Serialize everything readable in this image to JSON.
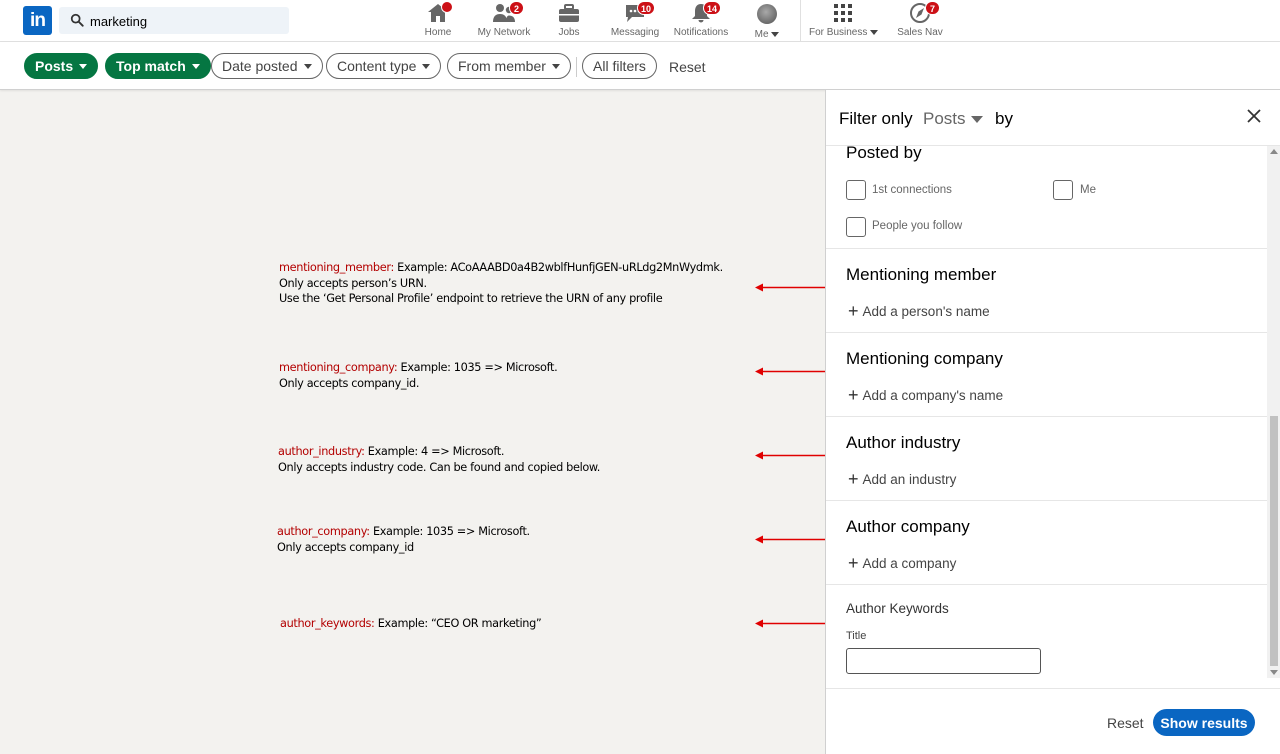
{
  "search": {
    "query": "marketing"
  },
  "nav": {
    "home": {
      "label": "Home",
      "badge": ""
    },
    "network": {
      "label": "My Network",
      "badge": "2"
    },
    "jobs": {
      "label": "Jobs"
    },
    "messaging": {
      "label": "Messaging",
      "badge": "10"
    },
    "notifications": {
      "label": "Notifications",
      "badge": "14"
    },
    "me": {
      "label": "Me"
    },
    "business": {
      "label": "For Business"
    },
    "salesnav": {
      "label": "Sales Nav",
      "badge": "7"
    }
  },
  "filters": {
    "posts": "Posts",
    "top_match": "Top match",
    "date_posted": "Date posted",
    "content_type": "Content type",
    "from_member": "From member",
    "all_filters": "All filters",
    "reset": "Reset"
  },
  "annotations": [
    {
      "key": "mentioning_member:",
      "lines": [
        "Example: ACoAAABD0a4B2wblfHunfjGEN-uRLdg2MnWydmk.",
        "Only accepts person’s URN.",
        "Use the ‘Get Personal Profile’ endpoint to retrieve the URN of any profile"
      ]
    },
    {
      "key": "mentioning_company:",
      "lines": [
        "Example: 1035 => Microsoft.",
        "Only accepts company_id."
      ]
    },
    {
      "key": "author_industry:",
      "lines": [
        "Example: 4 => Microsoft.",
        "Only accepts industry code. Can be found and copied below."
      ]
    },
    {
      "key": "author_company:",
      "lines": [
        "Example: 1035 => Microsoft.",
        "Only accepts company_id"
      ]
    },
    {
      "key": "author_keywords:",
      "lines": [
        "Example: “CEO OR marketing”"
      ]
    }
  ],
  "panel": {
    "filter_only": "Filter only",
    "posts": "Posts",
    "by": "by",
    "posted_by": {
      "title": "Posted by",
      "first_connections": "1st connections",
      "me": "Me",
      "people_you_follow": "People you follow"
    },
    "mentioning_member": {
      "title": "Mentioning member",
      "add": "Add a person's name"
    },
    "mentioning_company": {
      "title": "Mentioning company",
      "add": "Add a company's name"
    },
    "author_industry": {
      "title": "Author industry",
      "add": "Add an industry"
    },
    "author_company": {
      "title": "Author company",
      "add": "Add a company"
    },
    "author_keywords": {
      "title": "Author Keywords",
      "title_label": "Title",
      "title_value": ""
    },
    "footer": {
      "reset": "Reset",
      "show_results": "Show results"
    }
  },
  "colors": {
    "linkedin_blue": "#0a66c2",
    "active_pill_green": "#057642",
    "badge_red": "#cc1016",
    "annotation_key_red": "#b30000",
    "arrow_red": "#e00000"
  }
}
